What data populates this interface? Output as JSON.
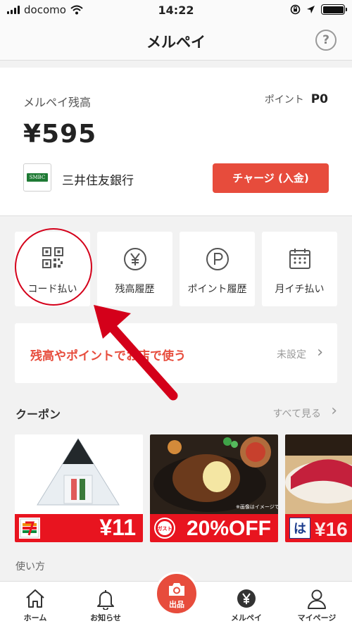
{
  "status_bar": {
    "carrier": "docomo",
    "time": "14:22"
  },
  "header": {
    "title": "メルペイ",
    "help_glyph": "?"
  },
  "balance": {
    "label": "メルペイ残高",
    "amount": "¥595",
    "points_label": "ポイント",
    "points_value": "P0",
    "bank_logo_text": "SMBC",
    "bank_name": "三井住友銀行",
    "charge_button": "チャージ (入金)"
  },
  "actions": [
    {
      "label": "コード払い",
      "icon": "qr-code-icon"
    },
    {
      "label": "残高履歴",
      "icon": "yen-circle-icon"
    },
    {
      "label": "ポイント履歴",
      "icon": "points-circle-icon"
    },
    {
      "label": "月イチ払い",
      "icon": "calendar-icon"
    }
  ],
  "stores": {
    "title": "残高やポイントでお店で使う",
    "status": "未設定"
  },
  "coupons": {
    "title": "クーポン",
    "see_all": "すべて見る",
    "items": [
      {
        "value": "¥11",
        "store": "7-Eleven"
      },
      {
        "value": "20%OFF",
        "store": "ガスト",
        "note": "※画像はイメージです"
      },
      {
        "value": "¥16",
        "store": "はま寿司"
      }
    ]
  },
  "usage": {
    "title": "使い方"
  },
  "tabbar": {
    "items": [
      {
        "label": "ホーム",
        "icon": "home-icon"
      },
      {
        "label": "お知らせ",
        "icon": "bell-icon"
      },
      {
        "label": "出品",
        "icon": "camera-icon"
      },
      {
        "label": "メルペイ",
        "icon": "yen-icon"
      },
      {
        "label": "マイページ",
        "icon": "person-icon"
      }
    ]
  },
  "colors": {
    "brand_red": "#e74c3c",
    "coupon_red": "#e8141f",
    "annotation_red": "#d4001a"
  }
}
